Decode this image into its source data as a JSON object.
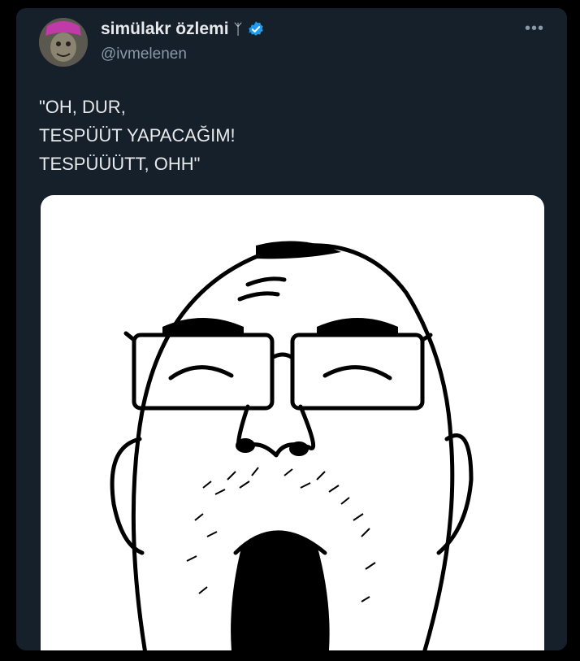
{
  "tweet": {
    "display_name": "simülakr özlemi",
    "name_emoji": "ᛉ",
    "handle": "@ivmelenen",
    "more_label": "•••",
    "text": "\"OH, DUR,\nTESPÜÜT YAPACAĞIM!\nTESPÜÜÜTT, OHH\""
  },
  "icons": {
    "verified": "verified-badge-icon",
    "more": "more-options-icon"
  },
  "colors": {
    "background": "#15202b",
    "verified_blue": "#1d9bf0",
    "text": "#e7e9ea",
    "muted": "#8b98a5"
  }
}
